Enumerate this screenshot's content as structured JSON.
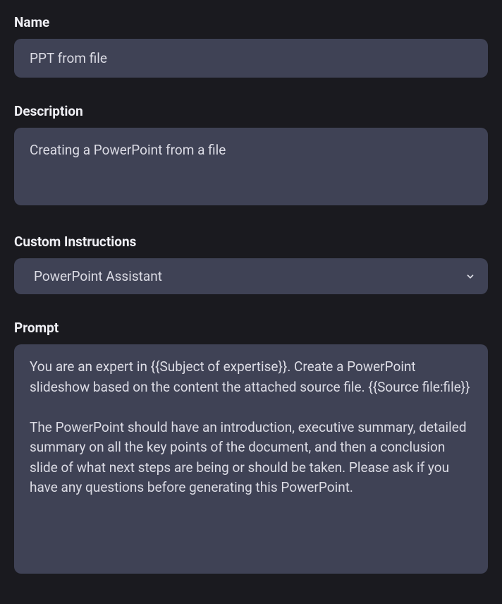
{
  "name": {
    "label": "Name",
    "value": "PPT from file"
  },
  "description": {
    "label": "Description",
    "value": "Creating a PowerPoint from a file"
  },
  "customInstructions": {
    "label": "Custom Instructions",
    "selected": "PowerPoint Assistant"
  },
  "prompt": {
    "label": "Prompt",
    "value": "You are an expert in {{Subject of expertise}}. Create a PowerPoint slideshow based on the content the attached source file. {{Source file:file}}\n\nThe PowerPoint should have an introduction, executive summary, detailed summary on all the key points of the document, and then a conclusion slide of what next steps are being or should be taken. Please ask if you have any questions before generating this PowerPoint."
  }
}
